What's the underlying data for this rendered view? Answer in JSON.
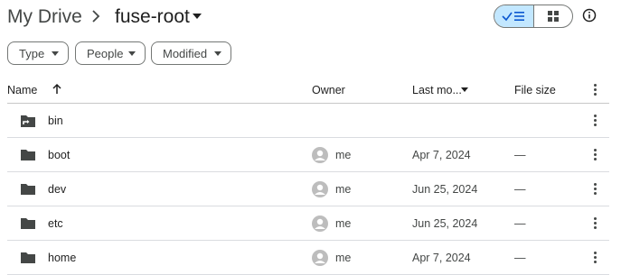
{
  "breadcrumb": {
    "root": "My Drive",
    "current": "fuse-root"
  },
  "icons": {
    "separator": "chevron-right-icon",
    "current_menu": "caret-down-icon",
    "list_view": "check-list-icon",
    "grid_view": "grid-icon",
    "info": "info-icon",
    "folder": "folder-icon",
    "shortcut_folder": "folder-shortcut-icon",
    "owner_avatar": "account-circle-icon",
    "sort": "arrow-up-icon",
    "more": "more-vert-icon"
  },
  "filters": [
    {
      "label": "Type"
    },
    {
      "label": "People"
    },
    {
      "label": "Modified"
    }
  ],
  "columns": {
    "name": "Name",
    "owner": "Owner",
    "modified": "Last mo...",
    "size": "File size"
  },
  "rows": [
    {
      "name": "bin",
      "owner": "",
      "modified": "",
      "size": "",
      "shortcut": true
    },
    {
      "name": "boot",
      "owner": "me",
      "modified": "Apr 7, 2024",
      "size": "—",
      "shortcut": false
    },
    {
      "name": "dev",
      "owner": "me",
      "modified": "Jun 25, 2024",
      "size": "—",
      "shortcut": false
    },
    {
      "name": "etc",
      "owner": "me",
      "modified": "Jun 25, 2024",
      "size": "—",
      "shortcut": false
    },
    {
      "name": "home",
      "owner": "me",
      "modified": "Apr 7, 2024",
      "size": "—",
      "shortcut": false
    }
  ],
  "colors": {
    "accent": "#c2e7ff",
    "icon": "#444746",
    "avatar": "#bdbdbd",
    "divider": "#dadce0"
  }
}
